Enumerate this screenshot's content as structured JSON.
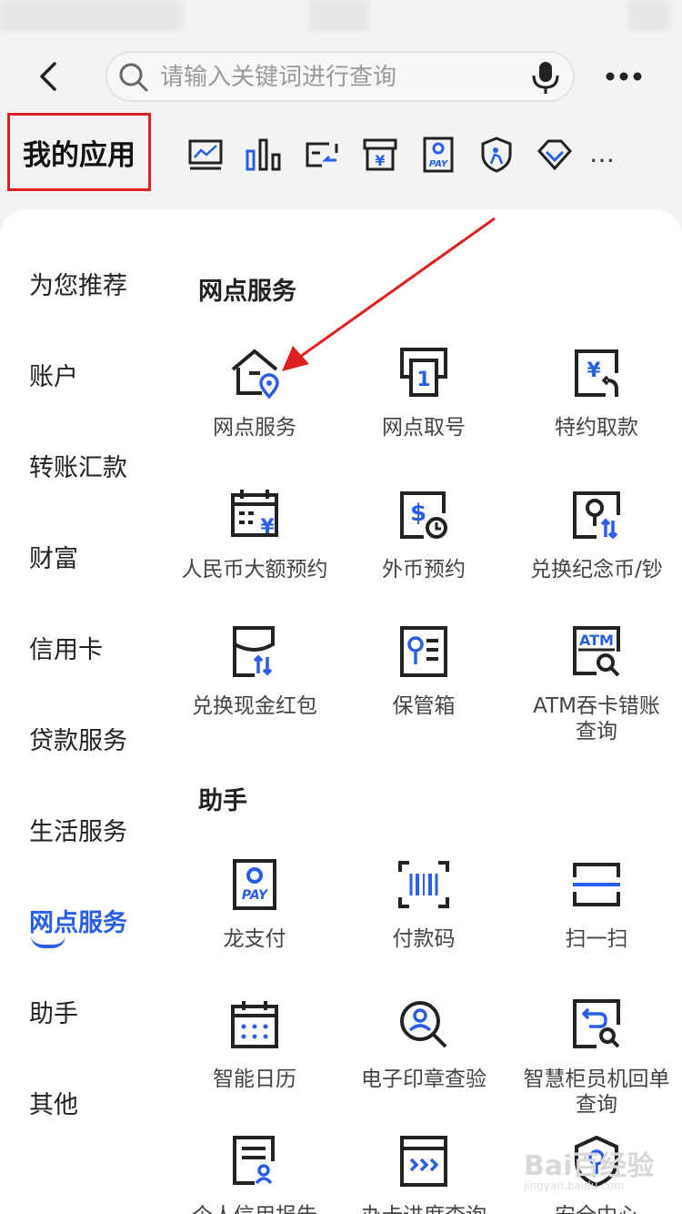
{
  "search": {
    "placeholder": "请输入关键词进行查询"
  },
  "my_apps": {
    "title": "我的应用",
    "more": "…"
  },
  "sidebar": {
    "items": [
      {
        "label": "为您推荐"
      },
      {
        "label": "账户"
      },
      {
        "label": "转账汇款"
      },
      {
        "label": "财富"
      },
      {
        "label": "信用卡"
      },
      {
        "label": "贷款服务"
      },
      {
        "label": "生活服务"
      },
      {
        "label": "网点服务"
      },
      {
        "label": "助手"
      },
      {
        "label": "其他"
      }
    ],
    "active_index": 7
  },
  "sections": [
    {
      "title": "网点服务",
      "items": [
        {
          "label": "网点服务",
          "icon": "branch-location-icon"
        },
        {
          "label": "网点取号",
          "icon": "queue-ticket-icon"
        },
        {
          "label": "特约取款",
          "icon": "special-withdrawal-icon"
        },
        {
          "label": "人民币大额预约",
          "icon": "rmb-reservation-icon"
        },
        {
          "label": "外币预约",
          "icon": "foreign-currency-icon"
        },
        {
          "label": "兑换纪念币/钞",
          "icon": "coin-exchange-icon"
        },
        {
          "label": "兑换现金红包",
          "icon": "cash-envelope-icon"
        },
        {
          "label": "保管箱",
          "icon": "safe-box-icon"
        },
        {
          "label": "ATM吞卡错账",
          "label2": "查询",
          "icon": "atm-query-icon"
        }
      ]
    },
    {
      "title": "助手",
      "items": [
        {
          "label": "龙支付",
          "icon": "long-pay-icon"
        },
        {
          "label": "付款码",
          "icon": "payment-code-icon"
        },
        {
          "label": "扫一扫",
          "icon": "scan-icon"
        },
        {
          "label": "智能日历",
          "icon": "calendar-icon"
        },
        {
          "label": "电子印章查验",
          "icon": "seal-verify-icon"
        },
        {
          "label": "智慧柜员机回单",
          "label2": "查询",
          "icon": "receipt-query-icon"
        },
        {
          "label": "个人信用报告",
          "icon": "credit-report-icon"
        },
        {
          "label": "办卡进度查询",
          "icon": "card-progress-icon"
        },
        {
          "label": "安全中心",
          "icon": "security-center-icon"
        }
      ]
    }
  ],
  "watermark": {
    "text": "Bai百经验",
    "sub": "jingyan.baidu.com"
  },
  "colors": {
    "accent": "#2a5ee6",
    "highlight": "#e02020"
  }
}
